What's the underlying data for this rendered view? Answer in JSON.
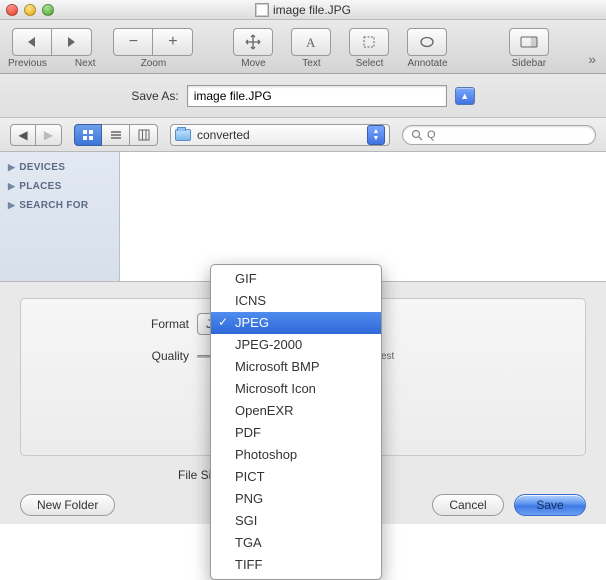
{
  "window": {
    "title": "image file.JPG"
  },
  "toolbar": {
    "previous": "Previous",
    "next": "Next",
    "zoom": "Zoom",
    "move": "Move",
    "text": "Text",
    "select": "Select",
    "annotate": "Annotate",
    "sidebar": "Sidebar"
  },
  "save_sheet": {
    "label": "Save As:",
    "filename": "image file.JPG",
    "folder": "converted",
    "search_placeholder": "Q",
    "sidebar_sections": [
      "DEVICES",
      "PLACES",
      "SEARCH FOR"
    ],
    "format_label": "Format",
    "quality_label": "Quality",
    "quality_hint": "est",
    "filesize_label": "File Size",
    "new_folder": "New Folder",
    "cancel": "Cancel",
    "save": "Save"
  },
  "format_menu": {
    "options": [
      "GIF",
      "ICNS",
      "JPEG",
      "JPEG-2000",
      "Microsoft BMP",
      "Microsoft Icon",
      "OpenEXR",
      "PDF",
      "Photoshop",
      "PICT",
      "PNG",
      "SGI",
      "TGA",
      "TIFF"
    ],
    "selected": "JPEG"
  }
}
